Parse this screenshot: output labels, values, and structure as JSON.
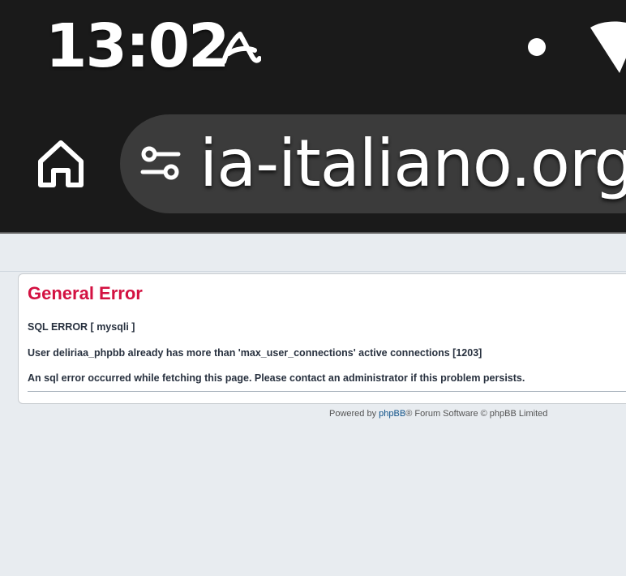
{
  "status_bar": {
    "time": "13:02",
    "app_icon": "avira-icon",
    "indicator_icon": "notification-dot-icon",
    "wifi_icon": "wifi-icon"
  },
  "toolbar": {
    "home_icon": "home-icon",
    "site_settings_icon": "tune-icon",
    "url": "ia-italiano.org"
  },
  "error": {
    "title": "General Error",
    "line1": "SQL ERROR [ mysqli ]",
    "line2": "User deliriaa_phpbb already has more than 'max_user_connections' active connections [1203]",
    "line3": "An sql error occurred while fetching this page. Please contact an administrator if this problem persists."
  },
  "footer": {
    "prefix": "Powered by ",
    "link_text": "phpBB",
    "suffix": "® Forum Software © phpBB Limited"
  },
  "colors": {
    "chrome_bg": "#1a1a1a",
    "url_bar_bg": "#3b3b3b",
    "page_bg": "#e8ecf0",
    "error_title": "#d31141",
    "text": "#28313f",
    "link": "#105289"
  }
}
